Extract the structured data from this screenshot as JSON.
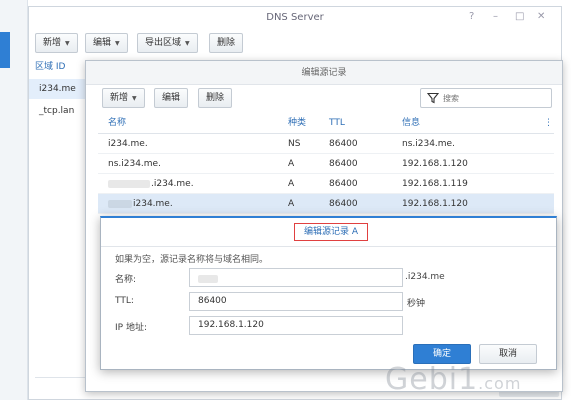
{
  "dns_window": {
    "title": "DNS Server",
    "controls": [
      "?",
      "–",
      "□",
      "✕"
    ],
    "toolbar": {
      "add_label": "新增",
      "edit_label": "编辑",
      "export_label": "导出区域",
      "delete_label": "删除"
    },
    "zone_header": "区域 ID",
    "zones": [
      "i234.me",
      "_tcp.lan"
    ]
  },
  "records_dialog": {
    "title": "编辑源记录",
    "toolbar": {
      "add_label": "新增",
      "edit_label": "编辑",
      "delete_label": "删除"
    },
    "search_placeholder": "搜索",
    "columns": [
      "名称",
      "种类",
      "TTL",
      "信息"
    ],
    "rows": [
      {
        "name": "i234.me.",
        "type": "NS",
        "ttl": "86400",
        "info": "ns.i234.me."
      },
      {
        "name": "ns.i234.me.",
        "type": "A",
        "ttl": "86400",
        "info": "192.168.1.120"
      },
      {
        "name": ".i234.me.",
        "type": "A",
        "ttl": "86400",
        "info": "192.168.1.119"
      },
      {
        "name": "i234.me.",
        "type": "A",
        "ttl": "86400",
        "info": "192.168.1.120"
      }
    ]
  },
  "edit_a_dialog": {
    "title": "编辑源记录 A",
    "hint": "如果为空，源记录名称将与域名相同。",
    "name_label": "名称:",
    "name_suffix": ".i234.me",
    "ttl_label": "TTL:",
    "ttl_value": "86400",
    "ttl_unit": "秒钟",
    "ip_label": "IP 地址:",
    "ip_value": "192.168.1.120",
    "ok_label": "确定",
    "cancel_label": "取消"
  },
  "watermark": {
    "text": "Gebi1",
    "suffix": ".com"
  }
}
